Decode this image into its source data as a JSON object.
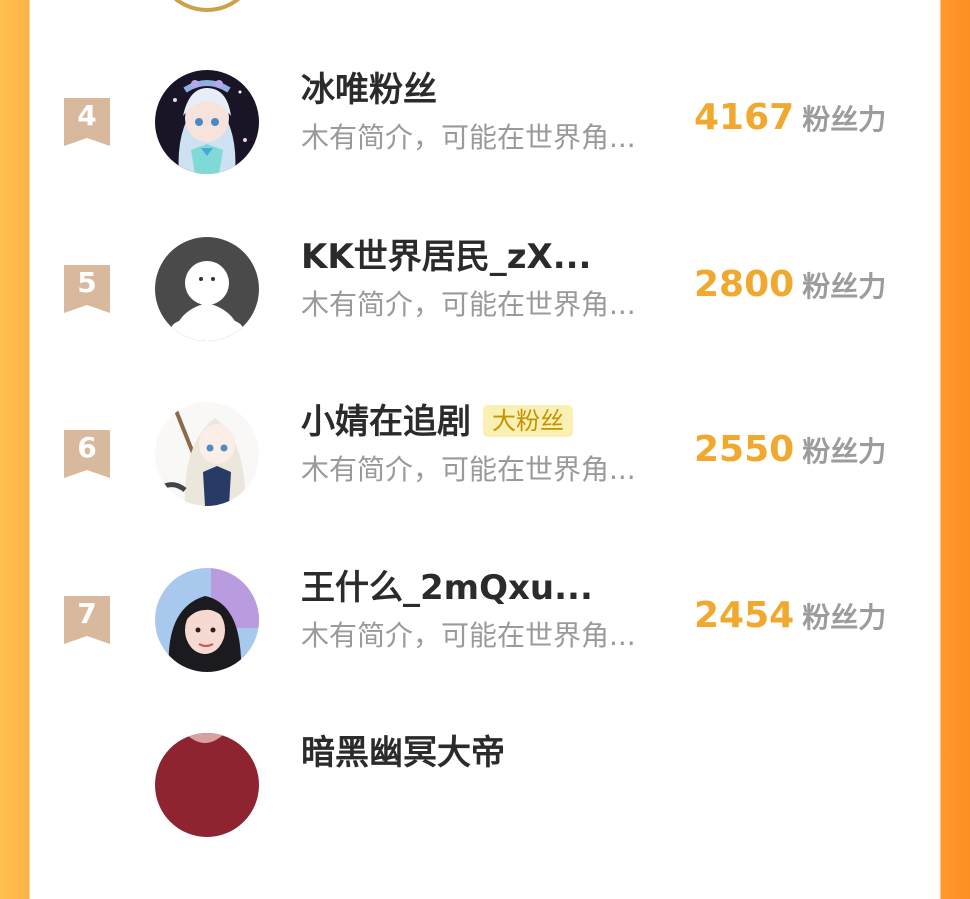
{
  "colors": {
    "accent": "#f0a82e",
    "badge_bg": "#fbf0b4",
    "badge_text": "#c49400",
    "rank_ribbon": "#d9b99e",
    "bio_text": "#9a9a9a",
    "unit_text": "#9c9c9c"
  },
  "rows": [
    {
      "rank": "4",
      "name": "冰唯粉丝",
      "badge": "",
      "bio": "木有简介，可能在世界角...",
      "score": "4167",
      "unit": "粉丝力",
      "avatar_icon": "anime-girl-avatar-icon"
    },
    {
      "rank": "5",
      "name": "KK世界居民_zX...",
      "badge": "",
      "bio": "木有简介，可能在世界角...",
      "score": "2800",
      "unit": "粉丝力",
      "avatar_icon": "default-user-avatar-icon"
    },
    {
      "rank": "6",
      "name": "小婧在追剧",
      "badge": "大粉丝",
      "bio": "木有简介，可能在世界角...",
      "score": "2550",
      "unit": "粉丝力",
      "avatar_icon": "anime-girl-avatar-icon"
    },
    {
      "rank": "7",
      "name": "王什么_2mQxu...",
      "badge": "",
      "bio": "木有简介，可能在世界角...",
      "score": "2454",
      "unit": "粉丝力",
      "avatar_icon": "photo-avatar-icon"
    },
    {
      "rank": "",
      "name": "暗黑幽冥大帝",
      "badge": "",
      "bio": "",
      "score": "",
      "unit": "",
      "avatar_icon": "photo-avatar-icon"
    }
  ]
}
